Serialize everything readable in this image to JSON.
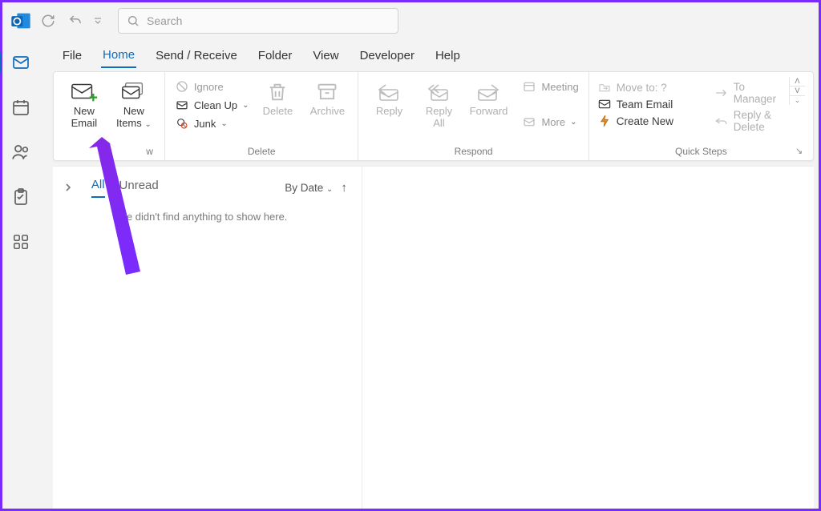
{
  "search": {
    "placeholder": "Search"
  },
  "menu": {
    "file": "File",
    "home": "Home",
    "sendreceive": "Send / Receive",
    "folder": "Folder",
    "view": "View",
    "developer": "Developer",
    "help": "Help"
  },
  "ribbon": {
    "new": {
      "caption": "w",
      "email": "New\nEmail",
      "items": "New\nItems"
    },
    "delete": {
      "caption": "Delete",
      "ignore": "Ignore",
      "cleanup": "Clean Up",
      "junk": "Junk",
      "delete": "Delete",
      "archive": "Archive"
    },
    "respond": {
      "caption": "Respond",
      "reply": "Reply",
      "replyall": "Reply\nAll",
      "forward": "Forward",
      "meeting": "Meeting",
      "more": "More"
    },
    "quicksteps": {
      "caption": "Quick Steps",
      "moveto": "Move to: ?",
      "team": "Team Email",
      "create": "Create New",
      "tomanager": "To Manager",
      "replydelete": "Reply & Delete"
    }
  },
  "list": {
    "all": "All",
    "unread": "Unread",
    "sort": "By Date",
    "empty": "We didn't find anything to show here."
  }
}
